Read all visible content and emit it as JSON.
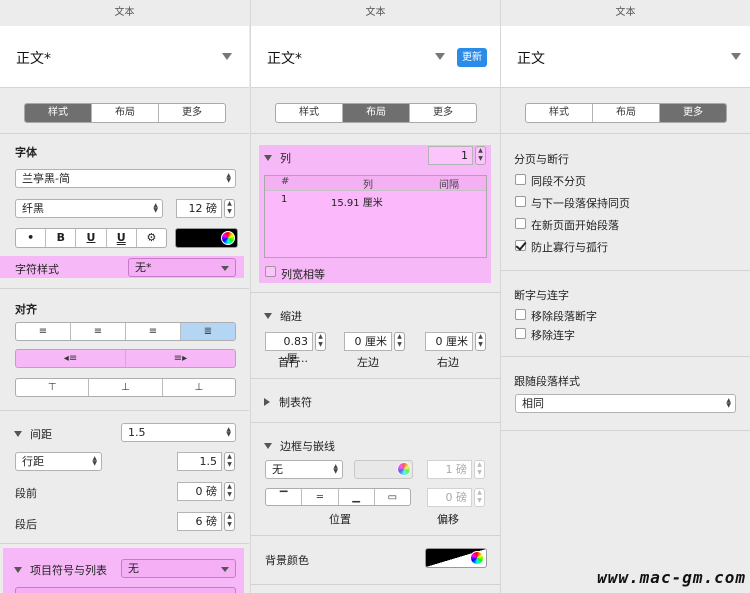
{
  "panels": {
    "p1": {
      "title": "文本",
      "style_name": "正文*",
      "tabs": [
        "样式",
        "布局",
        "更多"
      ],
      "font_header": "字体",
      "font_family": "兰亭黑-简",
      "font_weight": "纤黑",
      "font_size": "12 磅",
      "fmt_buttons": [
        "•",
        "B",
        "U",
        "U",
        "⚙"
      ],
      "char_style_label": "字符样式",
      "char_style_value": "无*",
      "align_header": "对齐",
      "spacing_label": "间距",
      "spacing_value": "1.5",
      "line_spacing_type": "行距",
      "line_spacing_value": "1.5",
      "before_label": "段前",
      "before_value": "0 磅",
      "after_label": "段后",
      "after_value": "6 磅",
      "bullets_label": "项目符号与列表",
      "bullets_value": "无"
    },
    "p2": {
      "title": "文本",
      "style_name": "正文*",
      "update_button": "更新",
      "tabs": [
        "样式",
        "布局",
        "更多"
      ],
      "columns_label": "列",
      "columns_count": "1",
      "table_headers": [
        "#",
        "列",
        "间隔"
      ],
      "table_row": [
        "1",
        "15.91 厘米",
        ""
      ],
      "equal_width_label": "列宽相等",
      "indent_label": "缩进",
      "indent_first_value": "0.83 厘...",
      "indent_left_value": "0 厘米",
      "indent_right_value": "0 厘米",
      "indent_first_label": "首行",
      "indent_left_label": "左边",
      "indent_right_label": "右边",
      "tabs_label": "制表符",
      "border_label": "边框与嵌线",
      "border_style": "无",
      "border_width": "1 磅",
      "border_offset": "0 磅",
      "position_label": "位置",
      "offset_label": "偏移",
      "background_color_label": "背景颜色"
    },
    "p3": {
      "title": "文本",
      "style_name": "正文",
      "tabs": [
        "样式",
        "布局",
        "更多"
      ],
      "pagination_header": "分页与断行",
      "checkboxes": [
        {
          "label": "同段不分页",
          "checked": false
        },
        {
          "label": "与下一段落保持同页",
          "checked": false
        },
        {
          "label": "在新页面开始段落",
          "checked": false
        },
        {
          "label": "防止寡行与孤行",
          "checked": true
        }
      ],
      "hyphen_header": "断字与连字",
      "hyphen_checkboxes": [
        {
          "label": "移除段落断字",
          "checked": false
        },
        {
          "label": "移除连字",
          "checked": false
        }
      ],
      "follow_style_header": "跟随段落样式",
      "follow_style_value": "相同"
    }
  },
  "watermark": "www.mac-gm.com",
  "colors": {
    "highlight": "#f7b8f7",
    "accent": "#2b8be8",
    "segment_selected": "#6f6f6f"
  }
}
